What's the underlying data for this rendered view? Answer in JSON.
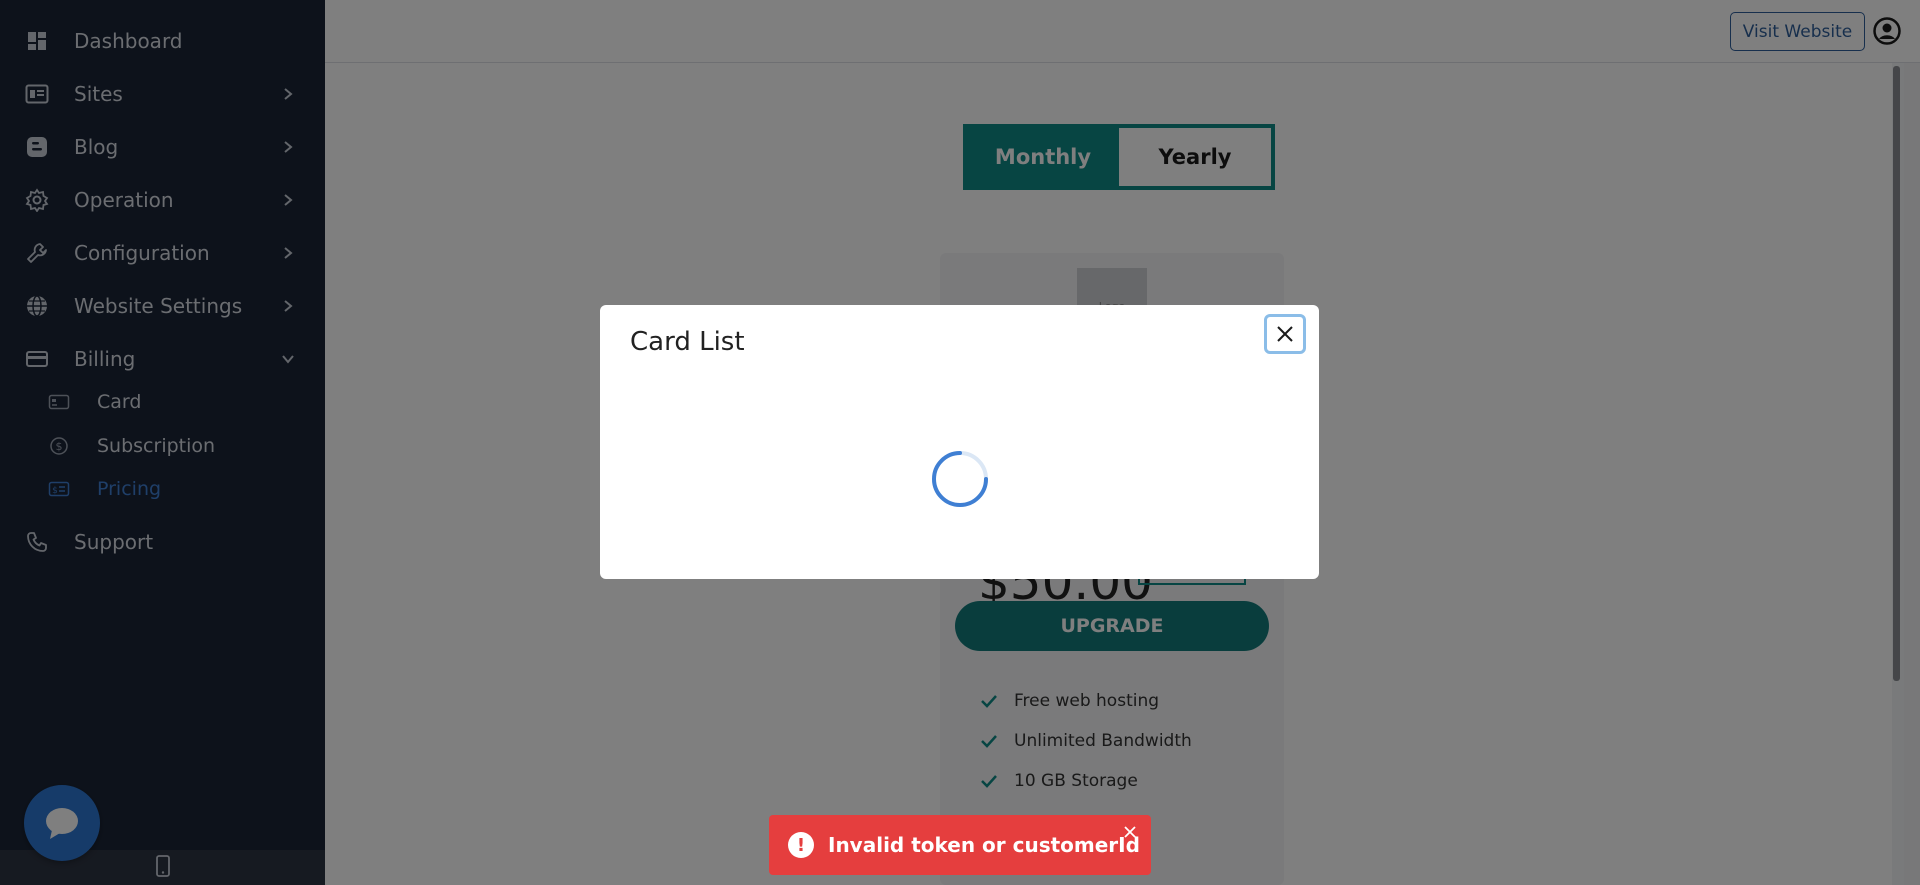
{
  "sidebar": {
    "items": [
      {
        "label": "Dashboard",
        "icon": "dashboard-icon"
      },
      {
        "label": "Sites",
        "icon": "sites-icon"
      },
      {
        "label": "Blog",
        "icon": "blog-icon"
      },
      {
        "label": "Operation",
        "icon": "gear-icon"
      },
      {
        "label": "Configuration",
        "icon": "wrench-icon"
      },
      {
        "label": "Website Settings",
        "icon": "globe-icon"
      },
      {
        "label": "Billing",
        "icon": "credit-card-icon"
      },
      {
        "label": "Support",
        "icon": "phone-icon"
      }
    ],
    "billing_sub": [
      {
        "label": "Card",
        "icon": "card-icon"
      },
      {
        "label": "Subscription",
        "icon": "dollar-circle-icon"
      },
      {
        "label": "Pricing",
        "icon": "pricing-icon"
      }
    ]
  },
  "header": {
    "visit_website": "Visit Website"
  },
  "pricing": {
    "toggle": {
      "monthly": "Monthly",
      "yearly": "Yearly",
      "selected": "Monthly"
    },
    "plan": {
      "logo_text": "Logo",
      "price": "$50.00",
      "upgrade_label": "UPGRADE",
      "features": [
        "Free web hosting",
        "Unlimited Bandwidth",
        "10 GB Storage"
      ]
    }
  },
  "modal": {
    "title": "Card List"
  },
  "toast": {
    "message": "Invalid token or customerId"
  },
  "colors": {
    "sidebar_bg": "#1b2537",
    "accent_teal": "#0f8a87",
    "active_blue": "#3f7fd3",
    "toast_red": "#e53e3e"
  }
}
